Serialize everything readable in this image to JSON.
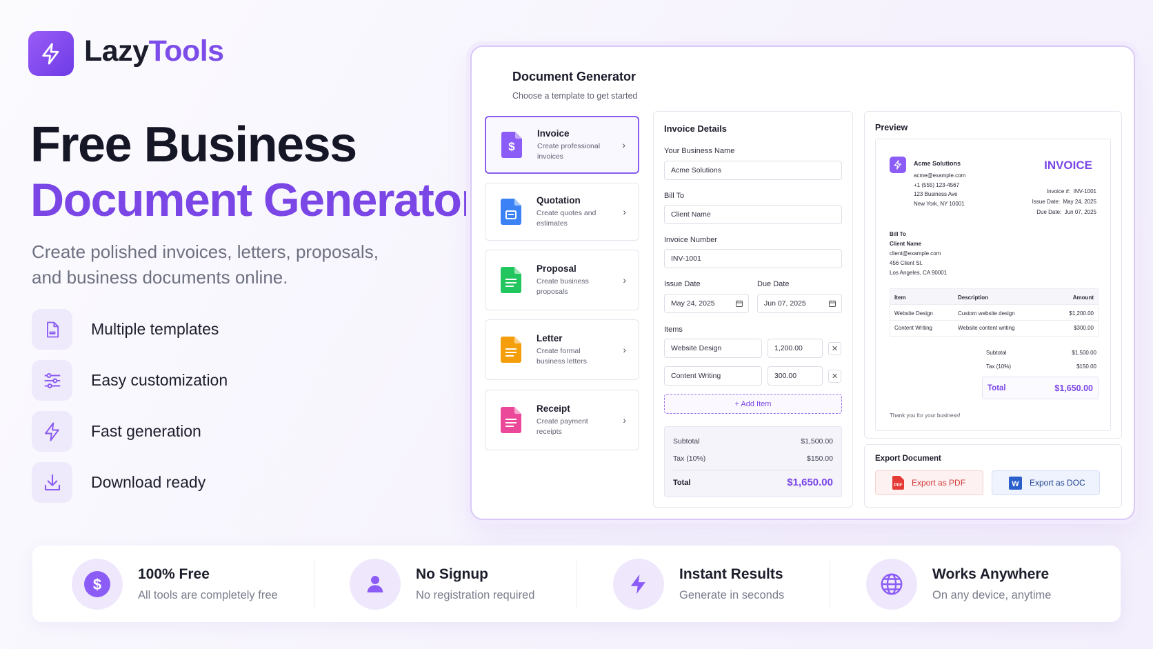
{
  "brand": {
    "name_part1": "Lazy",
    "name_part2": "Tools",
    "icon": "lightning-bolt-icon"
  },
  "hero": {
    "title_line1": "Free Business",
    "title_line2": "Document Generators",
    "subtitle_line1": "Create polished invoices, letters, proposals,",
    "subtitle_line2": "and business documents online."
  },
  "features": [
    {
      "icon": "document-icon",
      "label": "Multiple templates"
    },
    {
      "icon": "sliders-icon",
      "label": "Easy customization"
    },
    {
      "icon": "lightning-icon",
      "label": "Fast generation"
    },
    {
      "icon": "download-icon",
      "label": "Download ready"
    }
  ],
  "app": {
    "title": "Document Generator",
    "subtitle": "Choose a template to get started",
    "templates": [
      {
        "name": "Invoice",
        "desc": "Create professional invoices",
        "color": "#8b5cf6",
        "icon": "invoice-doc-icon"
      },
      {
        "name": "Quotation",
        "desc": "Create quotes and estimates",
        "color": "#3b82f6",
        "icon": "quotation-doc-icon"
      },
      {
        "name": "Proposal",
        "desc": "Create business proposals",
        "color": "#22c55e",
        "icon": "proposal-doc-icon"
      },
      {
        "name": "Letter",
        "desc": "Create formal business letters",
        "color": "#f59e0b",
        "icon": "letter-doc-icon"
      },
      {
        "name": "Receipt",
        "desc": "Create payment receipts",
        "color": "#ec4899",
        "icon": "receipt-doc-icon"
      }
    ],
    "form": {
      "title": "Invoice Details",
      "business_label": "Your Business Name",
      "business_value": "Acme Solutions",
      "billto_label": "Bill To",
      "billto_placeholder": "Client Name",
      "number_label": "Invoice Number",
      "number_value": "INV-1001",
      "issue_label": "Issue Date",
      "issue_value": "May 24, 2025",
      "due_label": "Due Date",
      "due_value": "Jun 07, 2025",
      "items_label": "Items",
      "items": [
        {
          "desc": "Website Design",
          "amount": "1,200.00"
        },
        {
          "desc": "Content Writing",
          "amount": "300.00"
        }
      ],
      "add_item": "+ Add Item",
      "subtotal_label": "Subtotal",
      "subtotal_value": "$1,500.00",
      "tax_label": "Tax (10%)",
      "tax_value": "$150.00",
      "total_label": "Total",
      "total_value": "$1,650.00"
    },
    "preview": {
      "title": "Preview",
      "company": "Acme Solutions",
      "email": "acme@example.com",
      "phone": "+1 (555) 123-4567",
      "addr1": "123 Business Ave",
      "addr2": "New York, NY 10001",
      "doc_title": "INVOICE",
      "inv_no_label": "Invoice #:",
      "inv_no": "INV-1001",
      "issue_label": "Issue Date:",
      "issue": "May 24, 2025",
      "due_label": "Due Date:",
      "due": "Jun 07, 2025",
      "billto_label": "Bill To",
      "client": "Client Name",
      "client_email": "client@example.com",
      "client_addr1": "456 Client St.",
      "client_addr2": "Los Angeles, CA 90001",
      "col_item": "Item",
      "col_desc": "Description",
      "col_amount": "Amount",
      "rows": [
        {
          "item": "Website Design",
          "desc": "Custom website design",
          "amount": "$1,200.00"
        },
        {
          "item": "Content Writing",
          "desc": "Website content writing",
          "amount": "$300.00"
        }
      ],
      "subtotal_label": "Subtotal",
      "subtotal": "$1,500.00",
      "tax_label": "Tax (10%)",
      "tax": "$150.00",
      "total_label": "Total",
      "total": "$1,650.00",
      "thanks": "Thank you for your business!"
    },
    "export": {
      "title": "Export Document",
      "pdf_label": "Export as PDF",
      "doc_label": "Export as DOC"
    }
  },
  "benefits": [
    {
      "icon": "dollar-icon",
      "title": "100% Free",
      "desc": "All tools are completely free"
    },
    {
      "icon": "user-icon",
      "title": "No Signup",
      "desc": "No registration required"
    },
    {
      "icon": "lightning-icon",
      "title": "Instant Results",
      "desc": "Generate in seconds"
    },
    {
      "icon": "globe-icon",
      "title": "Works Anywhere",
      "desc": "On any device, anytime"
    }
  ]
}
